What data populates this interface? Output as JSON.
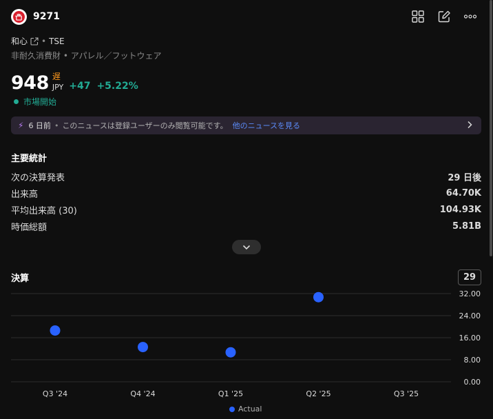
{
  "header": {
    "ticker": "9271",
    "icons": [
      "grid-icon",
      "edit-icon",
      "more-icon"
    ]
  },
  "company": {
    "name": "和心",
    "exchange": "TSE",
    "separator": "•",
    "sector": "非耐久消費財 • アパレル／フットウェア"
  },
  "quote": {
    "price": "948",
    "delay_label": "遅",
    "currency": "JPY",
    "change": "+47",
    "change_pct": "+5.22%",
    "market_status": "市場開始",
    "colors": {
      "up": "#22ab94",
      "delay": "#f7941d"
    }
  },
  "news": {
    "age": "6 日前",
    "separator": "•",
    "message": "このニュースは登録ユーザーのみ閲覧可能です。",
    "link": "他のニュースを見る"
  },
  "key_stats": {
    "title": "主要統計",
    "rows": [
      {
        "label": "次の決算発表",
        "value": "29 日後"
      },
      {
        "label": "出来高",
        "value": "64.70K"
      },
      {
        "label": "平均出来高 (30)",
        "value": "104.93K"
      },
      {
        "label": "時価総額",
        "value": "5.81B"
      }
    ]
  },
  "earnings": {
    "title": "決算",
    "badge": "29",
    "legend": "Actual"
  },
  "chart_data": {
    "type": "scatter",
    "categories": [
      "Q3 '24",
      "Q4 '24",
      "Q1 '25",
      "Q2 '25",
      "Q3 '25"
    ],
    "series": [
      {
        "name": "Actual",
        "values": [
          18.6,
          12.6,
          10.7,
          30.7,
          null
        ],
        "color": "#2962ff"
      }
    ],
    "yticks": [
      "32.00",
      "24.00",
      "16.00",
      "8.00",
      "0.00"
    ],
    "ylim": [
      0,
      32
    ],
    "grid": true
  }
}
